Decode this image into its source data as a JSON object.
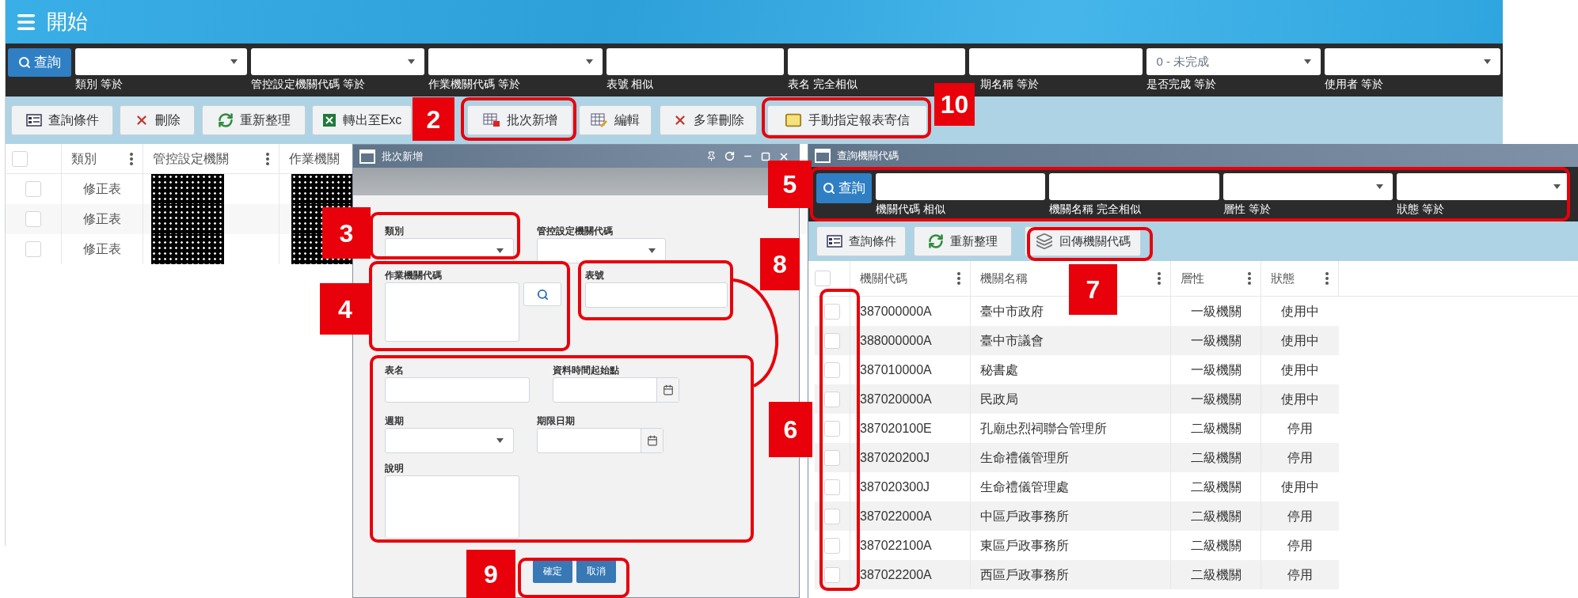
{
  "app_bar": {
    "title": "開始"
  },
  "filters": {
    "search_button": "查詢",
    "fields": [
      {
        "label": "類別 等於",
        "kind": "select"
      },
      {
        "label": "管控設定機關代碼 等於",
        "kind": "select"
      },
      {
        "label": "作業機關代碼 等於",
        "kind": "select"
      },
      {
        "label": "表號 相似",
        "kind": "text"
      },
      {
        "label": "表名 完全相似",
        "kind": "text"
      },
      {
        "label": "期名稱 等於",
        "kind": "text"
      },
      {
        "label": "是否完成 等於",
        "kind": "select",
        "value": "0 - 未完成"
      },
      {
        "label": "使用者 等於",
        "kind": "select"
      }
    ]
  },
  "toolbar": [
    "查詢條件",
    "刪除",
    "重新整理",
    "轉出至Exc",
    "批次新增",
    "編輯",
    "多筆刪除",
    "手動指定報表寄信"
  ],
  "grid": {
    "select_all_checked": false,
    "columns": [
      "類別",
      "管控設定機關",
      "作業機關"
    ],
    "rows": [
      {
        "checked": false,
        "category": "修正表"
      },
      {
        "checked": false,
        "category": "修正表"
      },
      {
        "checked": false,
        "category": "修正表"
      }
    ]
  },
  "batch_dialog": {
    "title": "批次新增",
    "fields": [
      {
        "label": "類別",
        "kind": "select"
      },
      {
        "label": "管控設定機關代碼",
        "kind": "select"
      },
      {
        "label": "作業機關代碼",
        "kind": "lookup"
      },
      {
        "label": "表號",
        "kind": "text"
      },
      {
        "label": "表名",
        "kind": "text"
      },
      {
        "label": "資料時間起始點",
        "kind": "date"
      },
      {
        "label": "週期",
        "kind": "select"
      },
      {
        "label": "期限日期",
        "kind": "date"
      },
      {
        "label": "說明",
        "kind": "textarea"
      }
    ],
    "buttons": [
      "確定",
      "取消"
    ]
  },
  "org_dialog": {
    "title": "查詢機關代碼",
    "search_button": "查詢",
    "filters": [
      {
        "label": "機關代碼 相似",
        "kind": "text"
      },
      {
        "label": "機關名稱 完全相似",
        "kind": "text"
      },
      {
        "label": "層性 等於",
        "kind": "select"
      },
      {
        "label": "狀態 等於",
        "kind": "select"
      }
    ],
    "toolbar": [
      "查詢條件",
      "重新整理",
      "回傳機關代碼"
    ],
    "select_all_checked": false,
    "columns": [
      "機關代碼",
      "機關名稱",
      "層性",
      "狀態"
    ],
    "rows": [
      {
        "checked": false,
        "cells": [
          "387000000A",
          "臺中市政府",
          "一級機關",
          "使用中"
        ]
      },
      {
        "checked": false,
        "cells": [
          "388000000A",
          "臺中市議會",
          "一級機關",
          "使用中"
        ]
      },
      {
        "checked": false,
        "cells": [
          "387010000A",
          "秘書處",
          "一級機關",
          "使用中"
        ]
      },
      {
        "checked": false,
        "cells": [
          "387020000A",
          "民政局",
          "一級機關",
          "使用中"
        ]
      },
      {
        "checked": false,
        "cells": [
          "387020100E",
          "孔廟忠烈祠聯合管理所",
          "二級機關",
          "停用"
        ]
      },
      {
        "checked": false,
        "cells": [
          "387020200J",
          "生命禮儀管理所",
          "二級機關",
          "停用"
        ]
      },
      {
        "checked": false,
        "cells": [
          "387020300J",
          "生命禮儀管理處",
          "二級機關",
          "使用中"
        ]
      },
      {
        "checked": false,
        "cells": [
          "387022000A",
          "中區戶政事務所",
          "二級機關",
          "停用"
        ]
      },
      {
        "checked": false,
        "cells": [
          "387022100A",
          "東區戶政事務所",
          "二級機關",
          "停用"
        ]
      },
      {
        "checked": false,
        "cells": [
          "387022200A",
          "西區戶政事務所",
          "二級機關",
          "停用"
        ]
      }
    ]
  },
  "annotations": [
    {
      "label": "2"
    },
    {
      "label": "10"
    },
    {
      "label": "5"
    },
    {
      "label": "3"
    },
    {
      "label": "8"
    },
    {
      "label": "4"
    },
    {
      "label": "7"
    },
    {
      "label": "6"
    },
    {
      "label": "9"
    }
  ]
}
